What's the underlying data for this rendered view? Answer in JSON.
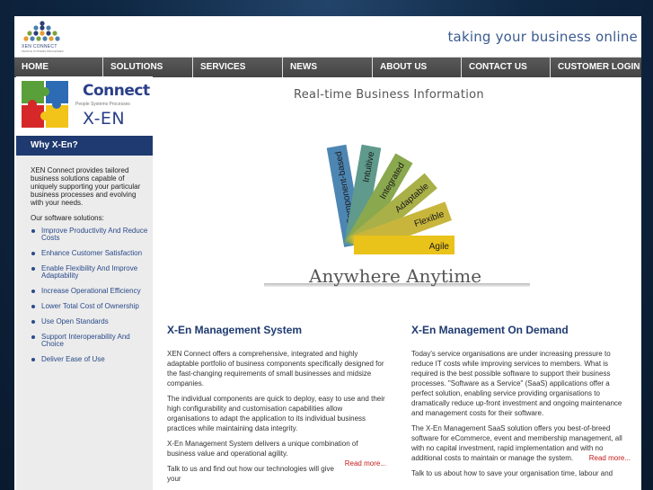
{
  "header": {
    "logo_text": "XEN CONNECT",
    "logo_sub": "PEOPLE SYSTEMS PROCESSES",
    "tagline": "taking your business online"
  },
  "nav": {
    "items": [
      "HOME",
      "SOLUTIONS",
      "SERVICES",
      "NEWS",
      "ABOUT US",
      "CONTACT US",
      "CUSTOMER LOGIN"
    ]
  },
  "sidebar": {
    "connect": "Connect",
    "people_line": "People Systems Processes",
    "xen": "X-EN",
    "why_title": "Why X-En?",
    "intro": "XEN Connect provides tailored business solutions capable of uniquely supporting your particular business processes and evolving with your needs.",
    "sub_heading": "Our software solutions:",
    "items": [
      "Improve Productivity And Reduce Costs",
      "Enhance Customer Satisfaction",
      "Enable Flexibility And Improve Adaptability",
      "Increase Operational Efficiency",
      "Lower Total Cost of Ownership",
      "Use Open Standards",
      "Support Interoperability And Choice",
      "Deliver Ease of Use"
    ]
  },
  "banner": {
    "title": "Real-time Business Information",
    "fan_labels": [
      "Component-based",
      "Intuitive",
      "Integrated",
      "Adaptable",
      "Flexible",
      "Agile"
    ],
    "fan_colors": [
      "#4d86b3",
      "#5f9a8c",
      "#8aa84e",
      "#a9b048",
      "#c8b63c",
      "#e9c21a"
    ],
    "slogan": "Anywhere Anytime"
  },
  "left": {
    "title": "X-En Management System",
    "p1": "XEN Connect offers a comprehensive, integrated and highly adaptable portfolio of business components specifically designed for the fast-changing requirements of small businesses and midsize companies.",
    "p2": "The individual components are quick to deploy, easy to use and their high configurability and customisation capabilities allow organisations to adapt the application to its individual business practices while maintaining data integrity.",
    "p3": "X-En Management System delivers a unique combination of business value and operational agility.",
    "readmore": "Read more...",
    "p4": "Talk to us and find out how our technologies will give your"
  },
  "right": {
    "title": "X-En Management On Demand",
    "p1": "Today's service organisations are under increasing pressure to reduce IT costs while improving services to members. What is required is the best possible software to support their business processes. \"Software as a Service\" (SaaS) applications offer a perfect solution, enabling service providing organisations to dramatically reduce up-front investment and ongoing maintenance and management costs for their software.",
    "p2": "The X-En Management SaaS solution offers you best-of-breed software for eCommerce, event and membership management, all with no capital investment, rapid implementation and with no additional costs to maintain or manage the system.",
    "readmore": "Read more...",
    "p3": "Talk to us about how to save your organisation time, labour and"
  }
}
